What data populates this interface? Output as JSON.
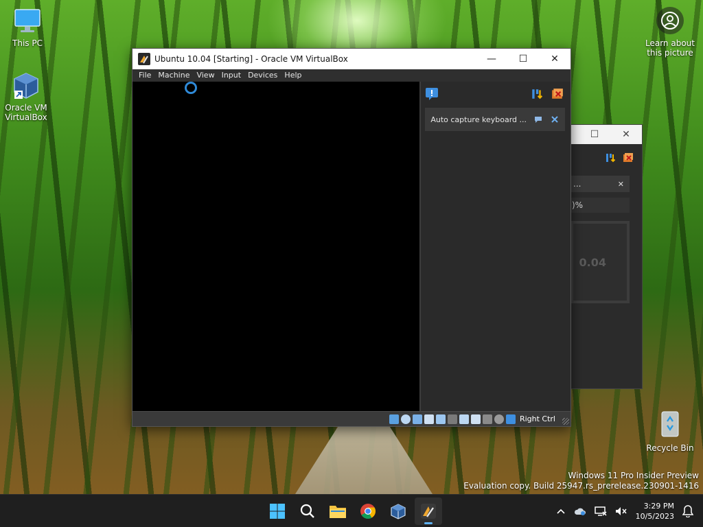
{
  "desktop": {
    "icons": [
      {
        "label": "This PC"
      },
      {
        "label": "Oracle VM VirtualBox"
      },
      {
        "label": "Recycle Bin"
      }
    ],
    "learn_picture": "Learn about this picture",
    "watermark": {
      "line1": "Windows 11 Pro Insider Preview",
      "line2": "Evaluation copy. Build 25947.rs_prerelease.230901-1416"
    }
  },
  "vm_window": {
    "title": "Ubuntu 10.04 [Starting] - Oracle VM VirtualBox",
    "menu": [
      "File",
      "Machine",
      "View",
      "Input",
      "Devices",
      "Help"
    ],
    "notification": "Auto capture keyboard ...",
    "host_key": "Right Ctrl"
  },
  "bg_window": {
    "notice_text": "...",
    "progress_text": ")%",
    "preview_text": "0.04"
  },
  "taskbar": {
    "time": "3:29 PM",
    "date": "10/5/2023"
  },
  "colors": {
    "accent": "#2f8ad8",
    "taskbar": "#1f1f1f",
    "vm_panel": "#2a2a2a"
  }
}
